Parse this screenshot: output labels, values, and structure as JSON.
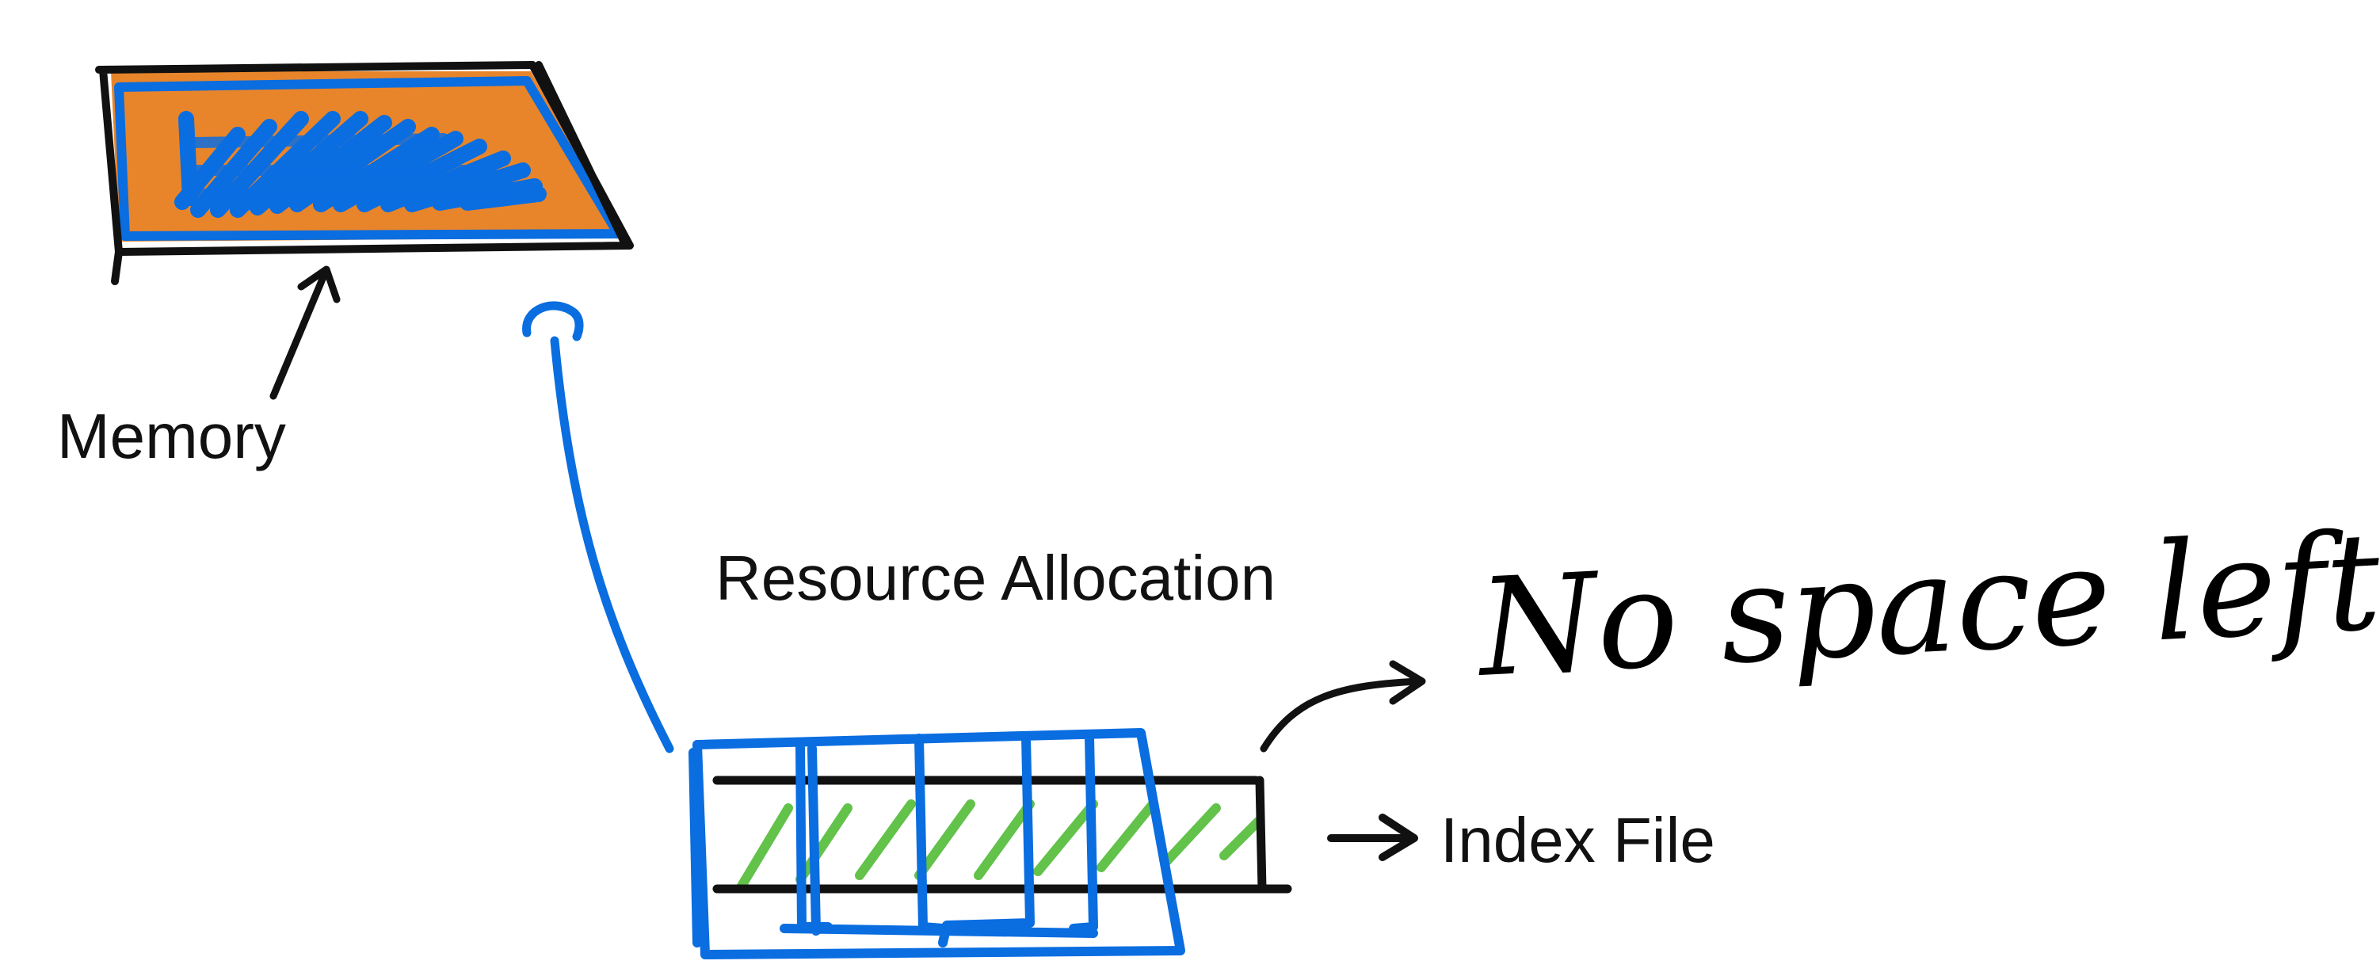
{
  "labels": {
    "memory": "Memory",
    "resource_allocation": "Resource Allocation",
    "index_file": "Index File",
    "no_space": "No space left!"
  },
  "colors": {
    "black_ink": "#111111",
    "blue_ink": "#0a6de0",
    "memory_fill": "#e8852a",
    "green_ink": "#62c24a",
    "background": "#ffffff"
  },
  "icons": {
    "memory_arrow": "arrow-up-icon",
    "pointer_arrow": "curved-arrow-icon",
    "index_arrow": "arrow-right-icon"
  }
}
